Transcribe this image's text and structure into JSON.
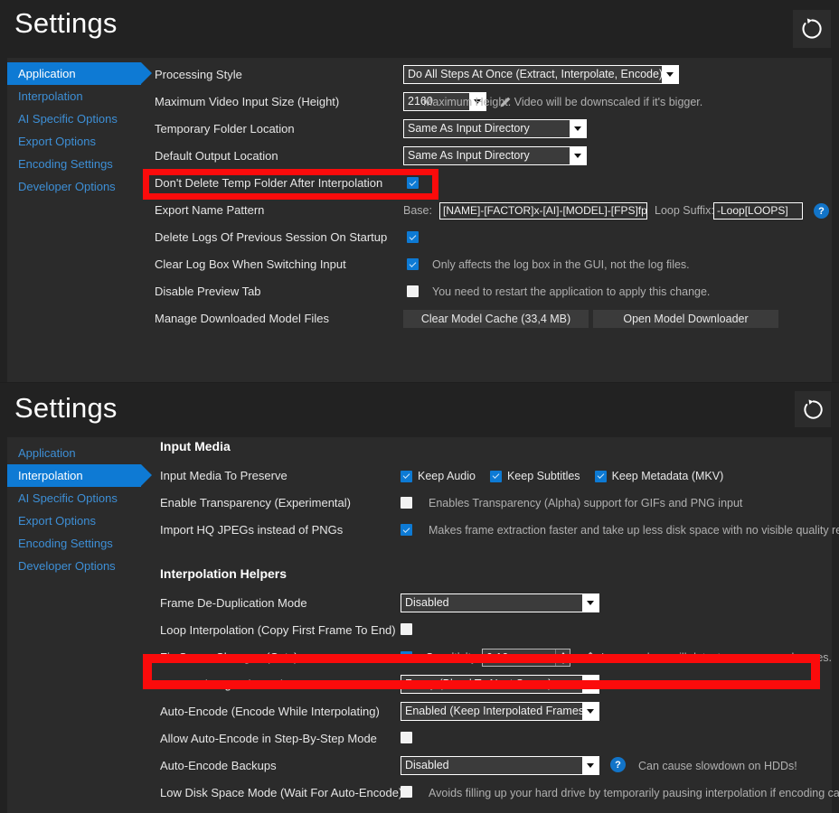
{
  "panels": [
    {
      "title": "Settings",
      "reset_icon": "reset-circular-arrow-icon",
      "sidebar": [
        {
          "label": "Application",
          "active": true
        },
        {
          "label": "Interpolation",
          "active": false
        },
        {
          "label": "AI Specific Options",
          "active": false
        },
        {
          "label": "Export Options",
          "active": false
        },
        {
          "label": "Encoding Settings",
          "active": false
        },
        {
          "label": "Developer Options",
          "active": false
        }
      ],
      "rows": {
        "processing_style": {
          "label": "Processing Style",
          "value": "Do All Steps At Once (Extract, Interpolate, Encode)"
        },
        "max_input_size": {
          "label": "Maximum Video Input Size (Height)",
          "value": "2160",
          "hint": "Maximum Height. Video will be downscaled if it's bigger."
        },
        "temp_folder": {
          "label": "Temporary Folder Location",
          "value": "Same As Input Directory"
        },
        "default_output": {
          "label": "Default Output Location",
          "value": "Same As Input Directory"
        },
        "dont_delete_temp": {
          "label": "Don't Delete Temp Folder After Interpolation",
          "checked": true
        },
        "export_name_pattern": {
          "label": "Export Name Pattern",
          "base_label": "Base:",
          "base_value": "[NAME]-[FACTOR]x-[AI]-[MODEL]-[FPS]fps",
          "loop_suffix_label": "Loop Suffix:",
          "loop_suffix_value": "-Loop[LOOPS]",
          "help": "?"
        },
        "delete_logs": {
          "label": "Delete Logs Of Previous Session On Startup",
          "checked": true
        },
        "clear_log_box": {
          "label": "Clear Log Box When Switching Input",
          "checked": true,
          "hint": "Only affects the log box in the GUI, not the log files."
        },
        "disable_preview": {
          "label": "Disable Preview Tab",
          "checked": false,
          "hint": "You need to restart the application to apply this change."
        },
        "manage_models": {
          "label": "Manage Downloaded Model Files",
          "clear_cache_button": "Clear Model Cache (33,4 MB)",
          "open_downloader_button": "Open Model Downloader"
        }
      }
    },
    {
      "title": "Settings",
      "reset_icon": "reset-circular-arrow-icon",
      "sidebar": [
        {
          "label": "Application",
          "active": false
        },
        {
          "label": "Interpolation",
          "active": true
        },
        {
          "label": "AI Specific Options",
          "active": false
        },
        {
          "label": "Export Options",
          "active": false
        },
        {
          "label": "Encoding Settings",
          "active": false
        },
        {
          "label": "Developer Options",
          "active": false
        }
      ],
      "sections": {
        "input_media": "Input Media",
        "interpolation_helpers": "Interpolation Helpers"
      },
      "rows": {
        "input_media_preserve": {
          "label": "Input Media To Preserve",
          "options": [
            {
              "label": "Keep Audio",
              "checked": true
            },
            {
              "label": "Keep Subtitles",
              "checked": true
            },
            {
              "label": "Keep Metadata (MKV)",
              "checked": true
            }
          ]
        },
        "enable_transparency": {
          "label": "Enable Transparency (Experimental)",
          "checked": false,
          "hint": "Enables Transparency (Alpha) support for GIFs and PNG input"
        },
        "import_hq_jpegs": {
          "label": "Import HQ JPEGs instead of PNGs",
          "checked": true,
          "hint": "Makes frame extraction faster and take up less disk space with no visible quality reduction."
        },
        "frame_dedup": {
          "label": "Frame De-Duplication Mode",
          "value": "Disabled"
        },
        "loop_interpolation": {
          "label": "Loop Interpolation (Copy First Frame To End)",
          "checked": false
        },
        "fix_scene_changes": {
          "label": "Fix Scene Changes (Cuts)",
          "checked": true,
          "sensitivity_label": "Sensitivity:",
          "sensitivity_value": "0,10",
          "hint": "Lower values will detect more scene changes."
        },
        "scene_change_fix_mode": {
          "label": "Scene Change Fix Mode",
          "value": "Fancy (Blend To Next Scene)"
        },
        "auto_encode": {
          "label": "Auto-Encode (Encode While Interpolating)",
          "value": "Enabled (Keep Interpolated Frames)"
        },
        "allow_auto_encode_sbs": {
          "label": "Allow Auto-Encode in Step-By-Step Mode",
          "checked": false
        },
        "auto_encode_backups": {
          "label": "Auto-Encode Backups",
          "value": "Disabled",
          "help": "?",
          "hint": "Can cause slowdown on HDDs!"
        },
        "low_disk_space_mode": {
          "label": "Low Disk Space Mode (Wait For Auto-Encode)",
          "checked": false,
          "hint": "Avoids filling up your hard drive by temporarily pausing interpolation if encoding can't keep up"
        }
      }
    }
  ],
  "annotations": {
    "highlight_color": "#fb0b0b",
    "highlight_1_target": "Don't Delete Temp Folder After Interpolation",
    "highlight_2_target": "Fix Scene Changes (Cuts)"
  }
}
